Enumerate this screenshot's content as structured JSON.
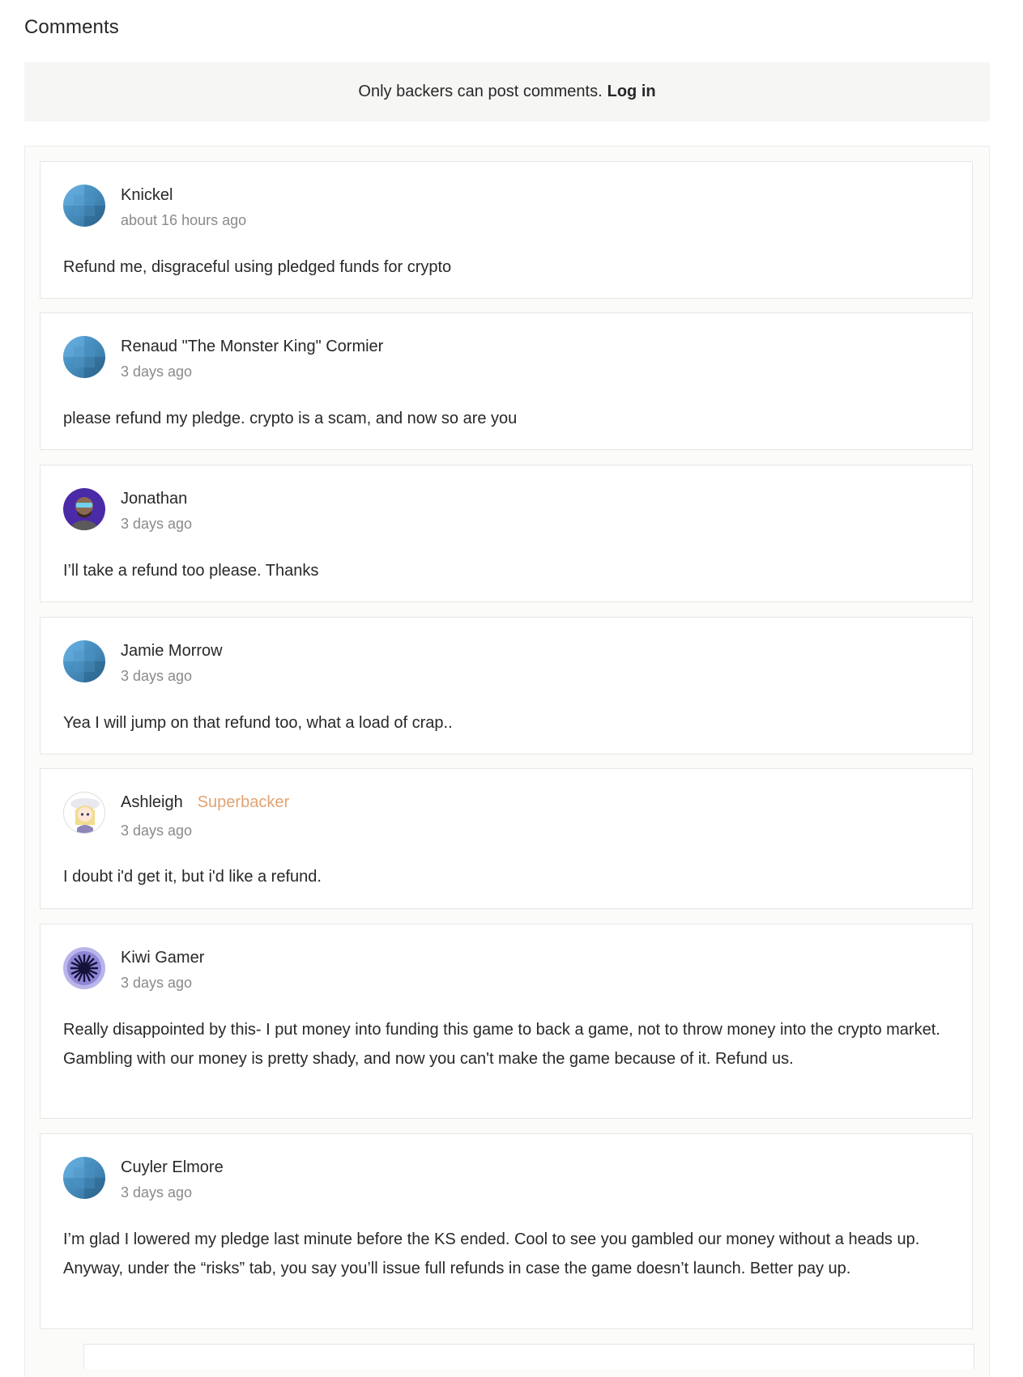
{
  "header": {
    "title": "Comments"
  },
  "notice": {
    "text": "Only backers can post comments.",
    "login_label": "Log in"
  },
  "comments": [
    {
      "name": "Knickel",
      "badge": "",
      "time": "about 16 hours ago",
      "body": "Refund me, disgraceful using pledged funds for crypto",
      "avatar": "default-avatar"
    },
    {
      "name": "Renaud \"The Monster King\" Cormier",
      "badge": "",
      "time": "3 days ago",
      "body": "please refund my pledge. crypto is a scam, and now so are you",
      "avatar": "default-avatar"
    },
    {
      "name": "Jonathan",
      "badge": "",
      "time": "3 days ago",
      "body": "I’ll take a refund too please. Thanks",
      "avatar": "photo-avatar"
    },
    {
      "name": "Jamie Morrow",
      "badge": "",
      "time": "3 days ago",
      "body": "Yea I will jump on that refund too, what a load of crap..",
      "avatar": "default-avatar"
    },
    {
      "name": "Ashleigh",
      "badge": "Superbacker",
      "time": "3 days ago",
      "body": "I doubt i'd get it, but i'd like a refund.",
      "avatar": "anime-avatar"
    },
    {
      "name": "Kiwi Gamer",
      "badge": "",
      "time": "3 days ago",
      "body": "Really disappointed by this- I put money into funding this game to back a game, not to throw money into the crypto market. Gambling with our money is pretty shady, and now you can't make the game because of it. Refund us.",
      "avatar": "burst-avatar"
    },
    {
      "name": "Cuyler Elmore",
      "badge": "",
      "time": "3 days ago",
      "body": "I’m glad I lowered my pledge last minute before the KS ended. Cool to see you gambled our money without a heads up. Anyway, under the “risks” tab, you say you’ll issue full refunds in case the game doesn’t launch. Better pay up.",
      "avatar": "default-avatar"
    }
  ],
  "colors": {
    "badge": "#e1a372",
    "meta": "#8a8a8a",
    "notice_bg": "#f6f6f5"
  }
}
